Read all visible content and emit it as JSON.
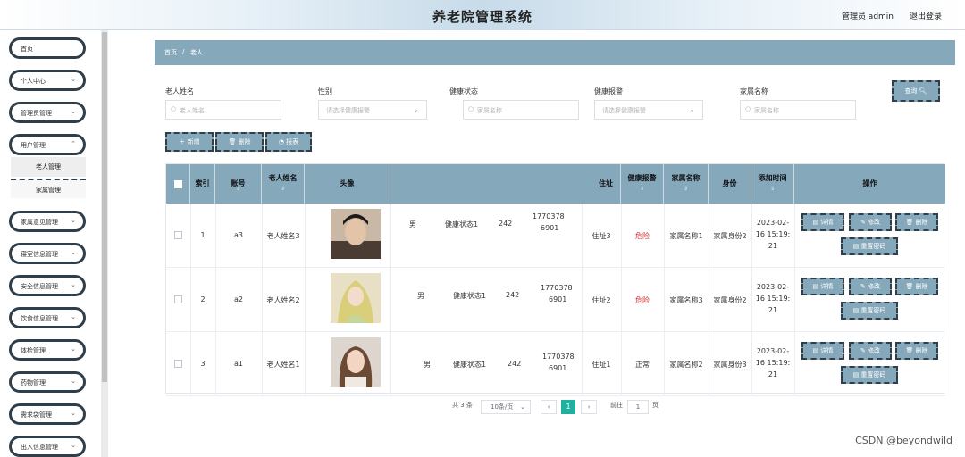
{
  "header": {
    "title": "养老院管理系统",
    "user": "管理员 admin",
    "logout": "退出登录"
  },
  "sidebar": {
    "items": [
      {
        "label": "首页"
      },
      {
        "label": "个人中心"
      },
      {
        "label": "管理员管理"
      },
      {
        "label": "用户管理"
      },
      {
        "label": "家属意见管理"
      },
      {
        "label": "寝室信息管理"
      },
      {
        "label": "安全信息管理"
      },
      {
        "label": "饮食信息管理"
      },
      {
        "label": "体检管理"
      },
      {
        "label": "药物管理"
      },
      {
        "label": "需求袋管理"
      },
      {
        "label": "出入信息管理"
      }
    ],
    "sub_items": [
      {
        "label": "老人管理"
      },
      {
        "label": "家属管理"
      }
    ]
  },
  "breadcrumb": {
    "home": "首页",
    "sep": "/",
    "current": "老人"
  },
  "filters": {
    "name_label": "老人姓名",
    "name_placeholder": "老人姓名",
    "gender_label": "性别",
    "gender_placeholder": "请选择健康报警",
    "health_label": "健康状态",
    "health_placeholder": "家属名称",
    "alarm_label": "健康报警",
    "alarm_placeholder": "请选择健康报警",
    "family_label": "家属名称",
    "family_placeholder": "家属名称",
    "search_button": "查询"
  },
  "toolbar": {
    "add": "新增",
    "delete": "删除",
    "report": "报表"
  },
  "table": {
    "headers": {
      "index": "索引",
      "account": "账号",
      "name": "老人姓名",
      "avatar": "头像",
      "address": "住址",
      "alarm": "健康报警",
      "family": "家属名称",
      "identity": "身份",
      "time": "添加时间",
      "ops": "操作"
    },
    "rows": [
      {
        "index": "1",
        "account": "a3",
        "name": "老人姓名3",
        "gender": "男",
        "health": "健康状态1",
        "room": "242",
        "phone1": "1770378",
        "phone2": "6901",
        "address": "住址3",
        "alarm": "危险",
        "alarm_danger": true,
        "family": "家属名称1",
        "identity": "家属身份2",
        "time1": "2023-02-",
        "time2": "16 15:19:",
        "time3": "21"
      },
      {
        "index": "2",
        "account": "a2",
        "name": "老人姓名2",
        "gender": "男",
        "health": "健康状态1",
        "room": "242",
        "phone1": "1770378",
        "phone2": "6901",
        "address": "住址2",
        "alarm": "危险",
        "alarm_danger": true,
        "family": "家属名称3",
        "identity": "家属身份2",
        "time1": "2023-02-",
        "time2": "16 15:19:",
        "time3": "21"
      },
      {
        "index": "3",
        "account": "a1",
        "name": "老人姓名1",
        "gender": "男",
        "health": "健康状态1",
        "room": "242",
        "phone1": "1770378",
        "phone2": "6901",
        "address": "住址1",
        "alarm": "正常",
        "alarm_danger": false,
        "family": "家属名称2",
        "identity": "家属身份3",
        "time1": "2023-02-",
        "time2": "16 15:19:",
        "time3": "21"
      }
    ],
    "actions": {
      "detail": "详情",
      "edit": "修改",
      "delete": "删除",
      "reset": "重置密码"
    }
  },
  "pager": {
    "total": "共 3 条",
    "page_size": "10条/页",
    "current": "1",
    "goto": "前往",
    "goto_value": "1",
    "page_unit": "页"
  },
  "watermark": "CSDN @beyondwild",
  "colors": {
    "accent": "#85a8bb",
    "border_dark": "#2f3e48",
    "page_active": "#1fb19e",
    "danger": "#d32f2f"
  }
}
